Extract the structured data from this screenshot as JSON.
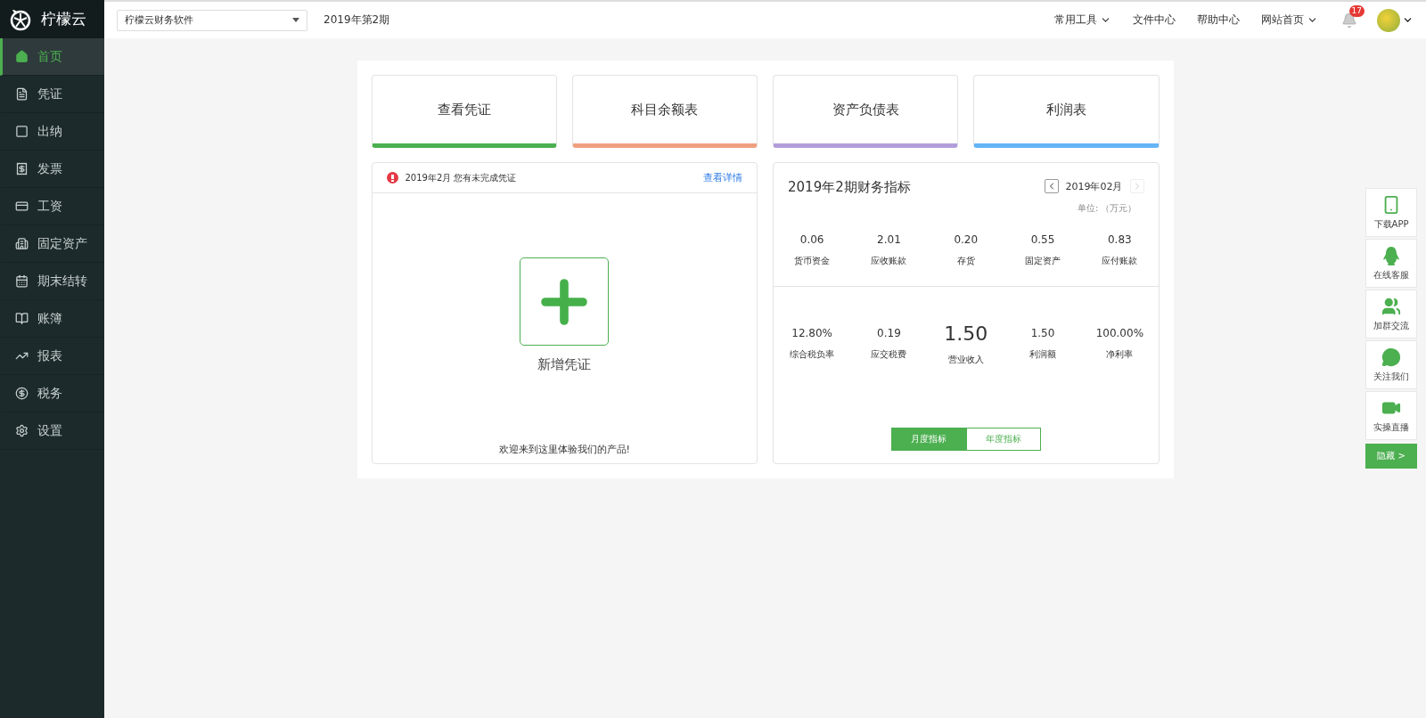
{
  "sidebar": {
    "logo": "柠檬云",
    "items": [
      {
        "kind": "home",
        "label": "首页",
        "selected": true
      },
      {
        "kind": "voucher",
        "label": "凭证",
        "selected": false
      },
      {
        "kind": "cash",
        "label": "出纳",
        "selected": false
      },
      {
        "kind": "invoice",
        "label": "发票",
        "selected": false
      },
      {
        "kind": "salary",
        "label": "工资",
        "selected": false
      },
      {
        "kind": "assets",
        "label": "固定资产",
        "selected": false
      },
      {
        "kind": "period",
        "label": "期末结转",
        "selected": false
      },
      {
        "kind": "ledger",
        "label": "账簿",
        "selected": false
      },
      {
        "kind": "report",
        "label": "报表",
        "selected": false
      },
      {
        "kind": "tax",
        "label": "税务",
        "selected": false
      },
      {
        "kind": "settings",
        "label": "设置",
        "selected": false
      }
    ]
  },
  "topbar": {
    "account_select": "柠檬云财务软件",
    "period": "2019年第2期",
    "menu": [
      {
        "label": "常用工具",
        "dropdown": true
      },
      {
        "label": "文件中心",
        "dropdown": false
      },
      {
        "label": "帮助中心",
        "dropdown": false
      },
      {
        "label": "网站首页",
        "dropdown": true
      }
    ],
    "notification_count": "17"
  },
  "shortcuts": [
    {
      "label": "查看凭证",
      "color": "#4caf50"
    },
    {
      "label": "科目余额表",
      "color": "#f0a080"
    },
    {
      "label": "资产负债表",
      "color": "#b39ddb"
    },
    {
      "label": "利润表",
      "color": "#64b5f6"
    }
  ],
  "voucher_panel": {
    "alert": "2019年2月 您有未完成凭证",
    "link": "查看详情",
    "add_label": "新增凭证",
    "welcome": "欢迎来到这里体验我们的产品!"
  },
  "metrics_panel": {
    "title": "2019年2期财务指标",
    "month": "2019年02月",
    "unit": "单位: （万元）",
    "top": [
      {
        "value": "0.06",
        "label": "货币资金",
        "highlight": false
      },
      {
        "value": "2.01",
        "label": "应收账款",
        "highlight": false
      },
      {
        "value": "0.20",
        "label": "存货",
        "highlight": false
      },
      {
        "value": "0.55",
        "label": "固定资产",
        "highlight": false
      },
      {
        "value": "0.83",
        "label": "应付账款",
        "highlight": false
      }
    ],
    "bottom": [
      {
        "value": "12.80%",
        "label": "综合税负率",
        "highlight": false
      },
      {
        "value": "0.19",
        "label": "应交税费",
        "highlight": false
      },
      {
        "value": "1.50",
        "label": "营业收入",
        "highlight": true
      },
      {
        "value": "1.50",
        "label": "利润额",
        "highlight": false
      },
      {
        "value": "100.00%",
        "label": "净利率",
        "highlight": false
      }
    ],
    "tabs": [
      {
        "label": "月度指标",
        "selected": true
      },
      {
        "label": "年度指标",
        "selected": false
      }
    ]
  },
  "float_bar": {
    "items": [
      {
        "kind": "phone",
        "label": "下载APP"
      },
      {
        "kind": "penguin",
        "label": "在线客服"
      },
      {
        "kind": "group",
        "label": "加群交流"
      },
      {
        "kind": "chat",
        "label": "关注我们"
      },
      {
        "kind": "video",
        "label": "实操直播"
      }
    ],
    "hide": "隐藏 >"
  }
}
